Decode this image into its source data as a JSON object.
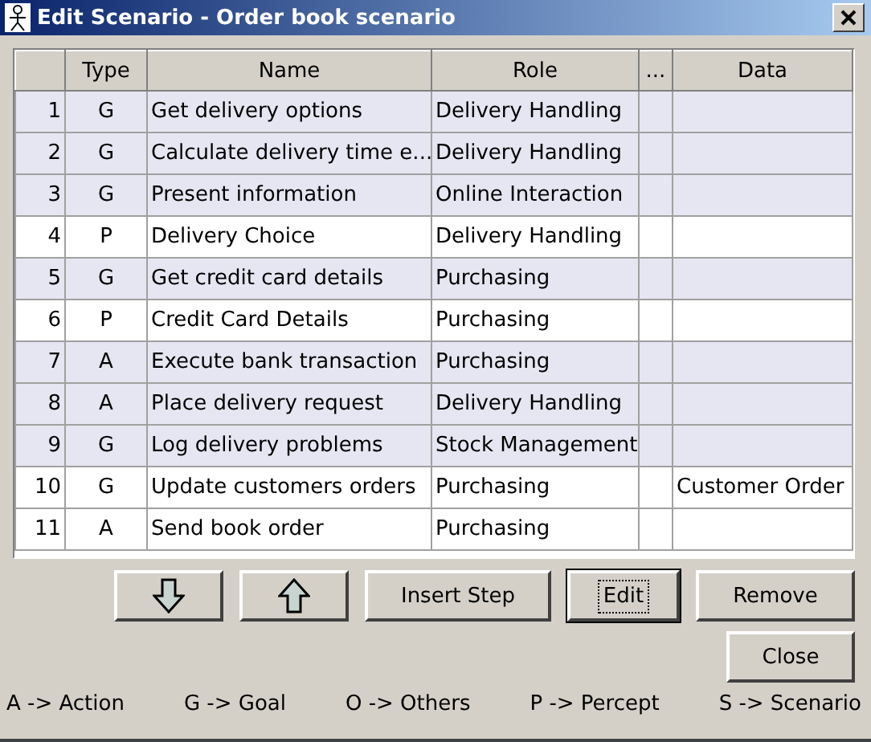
{
  "window": {
    "title": "Edit Scenario - Order book scenario"
  },
  "table": {
    "columns": [
      "Type",
      "Name",
      "Role",
      "...",
      "Data"
    ],
    "rows": [
      {
        "number": "1",
        "type": "G",
        "name": "Get delivery options",
        "role": "Delivery Handling",
        "selected": true
      },
      {
        "number": "2",
        "type": "G",
        "name": "Calculate delivery time e...",
        "role": "Delivery Handling",
        "selected": true
      },
      {
        "number": "3",
        "type": "G",
        "name": "Present information",
        "role": "Online Interaction",
        "selected": true
      },
      {
        "number": "4",
        "type": "P",
        "name": "Delivery Choice",
        "role": "Delivery Handling",
        "selected": false
      },
      {
        "number": "5",
        "type": "G",
        "name": "Get credit card details",
        "role": "Purchasing",
        "selected": true
      },
      {
        "number": "6",
        "type": "P",
        "name": "Credit Card Details",
        "role": "Purchasing",
        "selected": false
      },
      {
        "number": "7",
        "type": "A",
        "name": "Execute bank transaction",
        "role": "Purchasing",
        "selected": true
      },
      {
        "number": "8",
        "type": "A",
        "name": "Place delivery request",
        "role": "Delivery Handling",
        "selected": true
      },
      {
        "number": "9",
        "type": "G",
        "name": "Log delivery problems",
        "role": "Stock Management",
        "selected": true
      },
      {
        "number": "10",
        "type": "G",
        "name": "Update customers orders",
        "role": "Purchasing",
        "data": "Customer Order",
        "selected": false
      },
      {
        "number": "11",
        "type": "A",
        "name": "Send book order",
        "role": "Purchasing",
        "selected": false
      }
    ]
  },
  "buttons": [
    {
      "kind": "down"
    },
    {
      "kind": "up"
    },
    {
      "kind": "text",
      "label": "Insert Step",
      "focused": false
    },
    {
      "kind": "text",
      "label": "Edit",
      "focused": true
    },
    {
      "kind": "text",
      "label": "Remove",
      "focused": false
    }
  ],
  "close_button": "Close",
  "legend": [
    "A -> Action",
    "G -> Goal",
    "O -> Others",
    "P -> Percept",
    "S -> Scenario"
  ]
}
